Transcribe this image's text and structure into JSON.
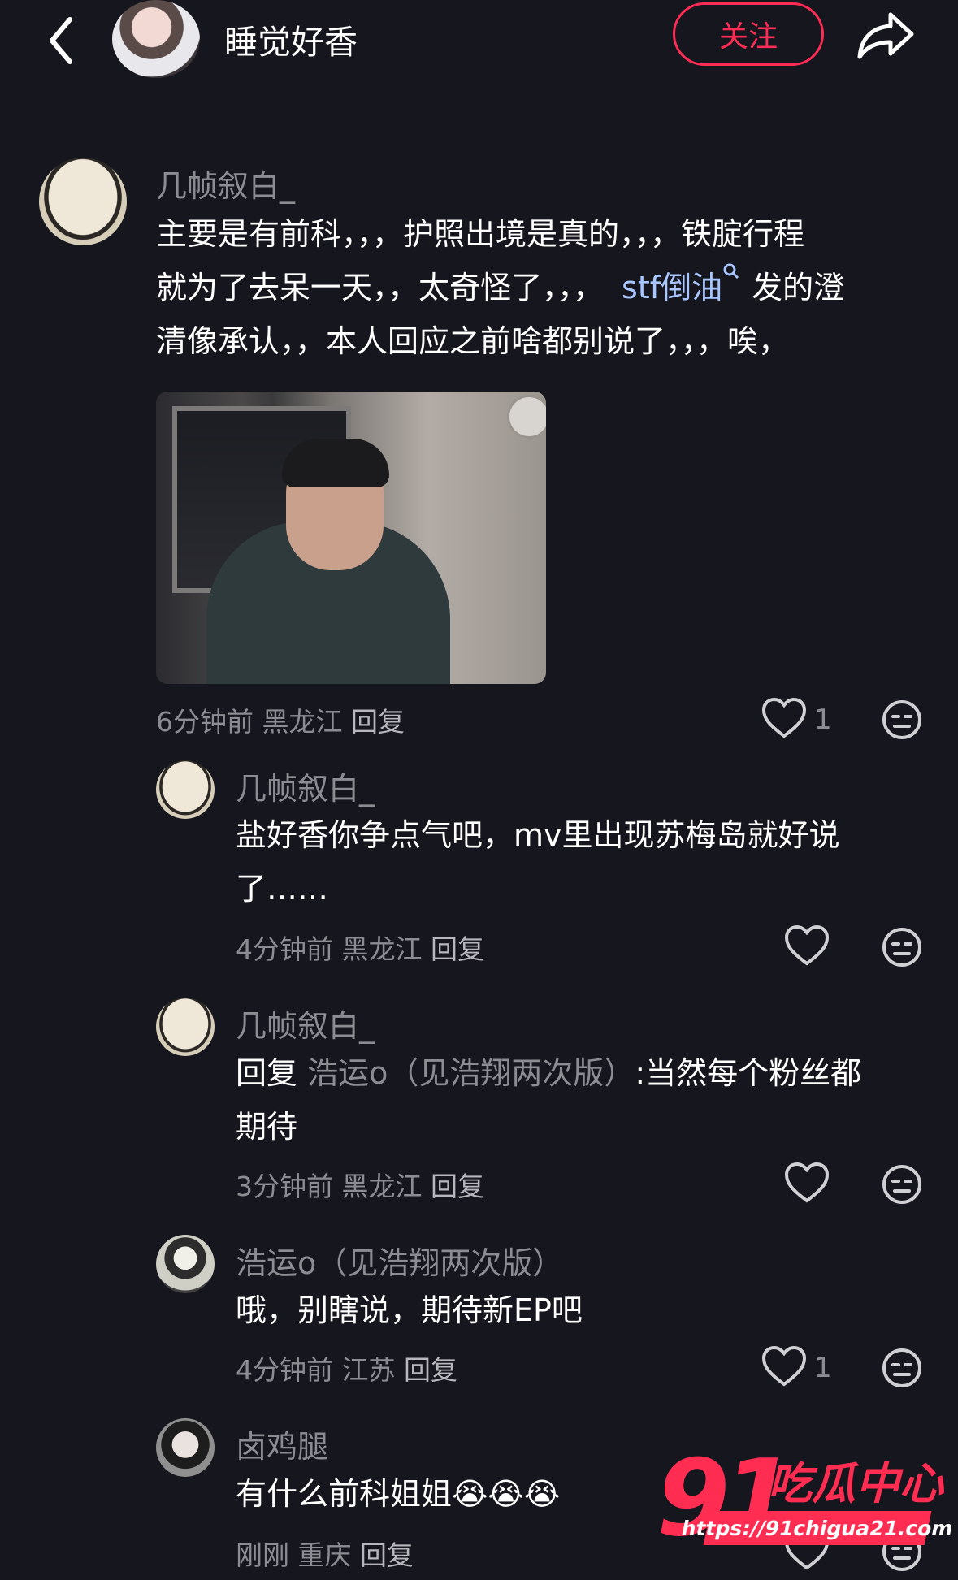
{
  "header": {
    "title": "睡觉好香",
    "follow_label": "关注"
  },
  "comment": {
    "username": "几帧叙白_",
    "text_1": "主要是有前科，，，护照出境是真的，，，铁腚行程",
    "text_2a": "就为了去呆一天，，太奇怪了，，，",
    "link": "stf倒油",
    "text_2b": "发的澄",
    "text_3": "清像承认，，本人回应之前啥都别说了，，，唉，",
    "time": "6分钟前",
    "location": "黑龙江",
    "reply_label": "回复",
    "likes": "1"
  },
  "replies": [
    {
      "username": "几帧叙白_",
      "text_1": "盐好香你争点气吧，mv里出现苏梅岛就好说",
      "text_2": "了……",
      "time": "4分钟前",
      "location": "黑龙江",
      "reply_label": "回复"
    },
    {
      "username": "几帧叙白_",
      "reply_prefix": "回复",
      "mention": "浩运o（见浩翔两次版）",
      "text_1": ":当然每个粉丝都",
      "text_2": "期待",
      "time": "3分钟前",
      "location": "黑龙江",
      "reply_label": "回复"
    },
    {
      "username": "浩运o（见浩翔两次版）",
      "text_1": "哦，别瞎说，期待新EP吧",
      "time": "4分钟前",
      "location": "江苏",
      "reply_label": "回复",
      "likes": "1"
    },
    {
      "username": "卤鸡腿",
      "text_1": "有什么前科姐姐",
      "emoji": "😭😭😭",
      "time": "刚刚",
      "location": "重庆",
      "reply_label": "回复"
    }
  ],
  "watermark": {
    "number": "91",
    "brand": "吃瓜中心",
    "url": "https://91chigua21.com"
  },
  "colors": {
    "background": "#16161e",
    "accent": "#fe2c55",
    "muted": "#8c8c93",
    "link": "#a9c6ff"
  }
}
